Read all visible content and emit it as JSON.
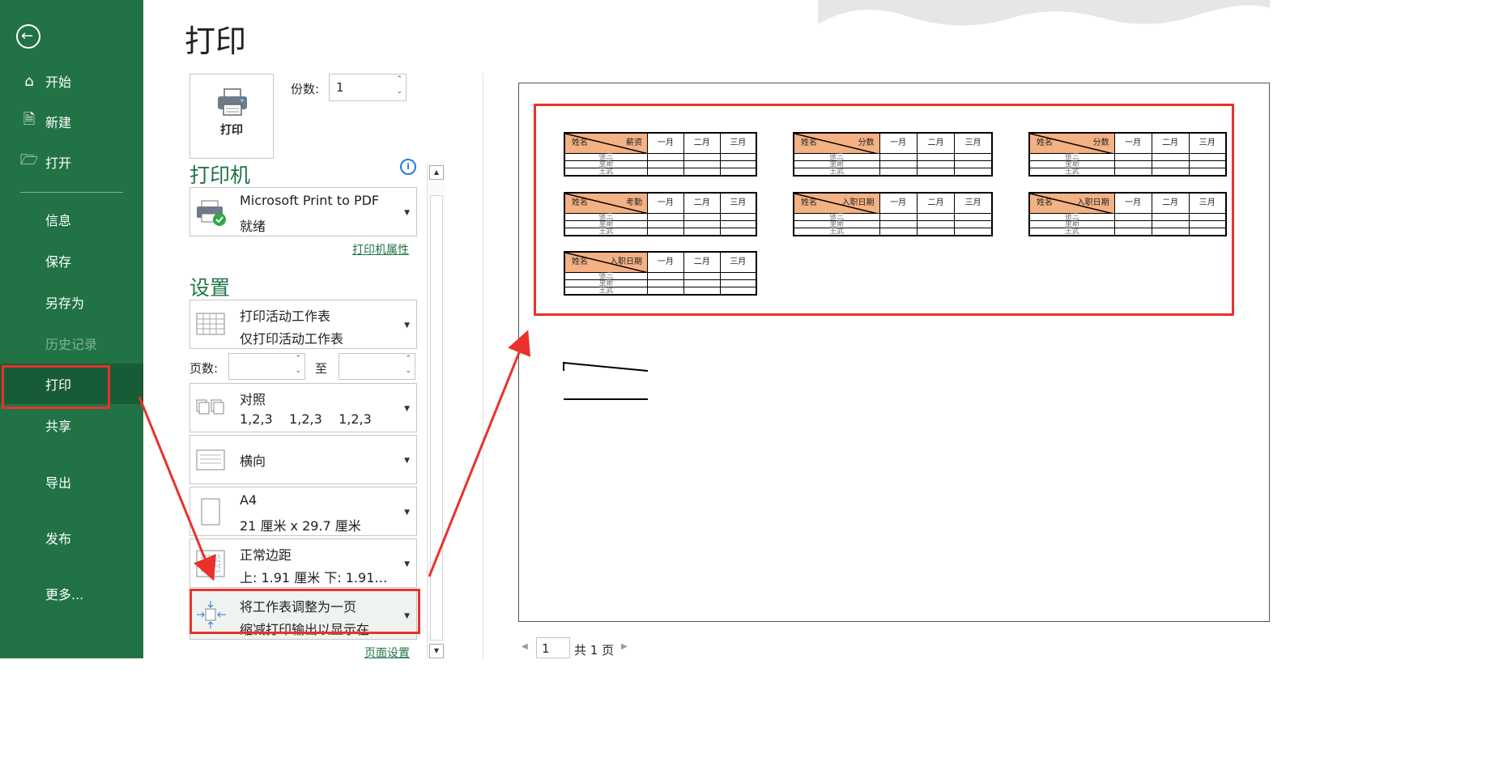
{
  "sidebar": {
    "back_icon": "arrow-left-circle-icon",
    "items": [
      {
        "label": "开始",
        "icon": "home-icon"
      },
      {
        "label": "新建",
        "icon": "document-icon"
      },
      {
        "label": "打开",
        "icon": "folder-open-icon"
      },
      {
        "label": "信息"
      },
      {
        "label": "保存"
      },
      {
        "label": "另存为"
      },
      {
        "label": "历史记录",
        "disabled": true
      },
      {
        "label": "打印",
        "active": true
      },
      {
        "label": "共享"
      },
      {
        "label": "导出"
      },
      {
        "label": "发布"
      },
      {
        "label": "更多..."
      }
    ]
  },
  "main": {
    "title": "打印",
    "print_button_label": "打印",
    "copies_label": "份数:",
    "copies_value": "1",
    "printer_section_title": "打印机",
    "printer": {
      "name": "Microsoft Print to PDF",
      "status": "就绪"
    },
    "printer_properties_link": "打印机属性",
    "settings_section_title": "设置",
    "settings": {
      "scope": {
        "line1": "打印活动工作表",
        "line2": "仅打印活动工作表"
      },
      "pages_label": "页数:",
      "pages_from": "",
      "pages_to_label": "至",
      "pages_to": "",
      "collate": {
        "line1": "对照",
        "line2": "1,2,3    1,2,3    1,2,3"
      },
      "orientation": {
        "line1": "横向"
      },
      "paper": {
        "line1": "A4",
        "line2": "21 厘米 x 29.7 厘米"
      },
      "margins": {
        "line1": "正常边距",
        "line2": "上: 1.91 厘米 下: 1.91…"
      },
      "scaling": {
        "line1": "将工作表调整为一页",
        "line2": "缩减打印输出以显示在…"
      }
    },
    "page_setup_link": "页面设置"
  },
  "preview": {
    "tables": [
      {
        "corner_left": "姓名",
        "corner_right": "薪资",
        "months": [
          "一月",
          "二月",
          "三月"
        ],
        "names": [
          "张三",
          "里斯",
          "王武"
        ]
      },
      {
        "corner_left": "姓名",
        "corner_right": "分数",
        "months": [
          "一月",
          "二月",
          "三月"
        ],
        "names": [
          "张三",
          "里斯",
          "王武"
        ]
      },
      {
        "corner_left": "姓名",
        "corner_right": "分数",
        "months": [
          "一月",
          "二月",
          "三月"
        ],
        "names": [
          "张三",
          "里斯",
          "王武"
        ]
      },
      {
        "corner_left": "姓名",
        "corner_right": "考勤",
        "months": [
          "一月",
          "二月",
          "三月"
        ],
        "names": [
          "张三",
          "里斯",
          "王武"
        ]
      },
      {
        "corner_left": "姓名",
        "corner_right": "入职日期",
        "months": [
          "一月",
          "二月",
          "三月"
        ],
        "names": [
          "张三",
          "里斯",
          "王武"
        ]
      },
      {
        "corner_left": "姓名",
        "corner_right": "入职日期",
        "months": [
          "一月",
          "二月",
          "三月"
        ],
        "names": [
          "张三",
          "里斯",
          "王武"
        ]
      },
      {
        "corner_left": "姓名",
        "corner_right": "入职日期",
        "months": [
          "一月",
          "二月",
          "三月"
        ],
        "names": [
          "张三",
          "里斯",
          "王武"
        ]
      }
    ]
  },
  "page_nav": {
    "current": "1",
    "total_text": "共 1 页"
  },
  "colors": {
    "sidebar": "#217346",
    "sidebar_active": "#185c37",
    "accent": "#217346",
    "annotation": "#e8322b",
    "table_header": "#f4b183"
  }
}
